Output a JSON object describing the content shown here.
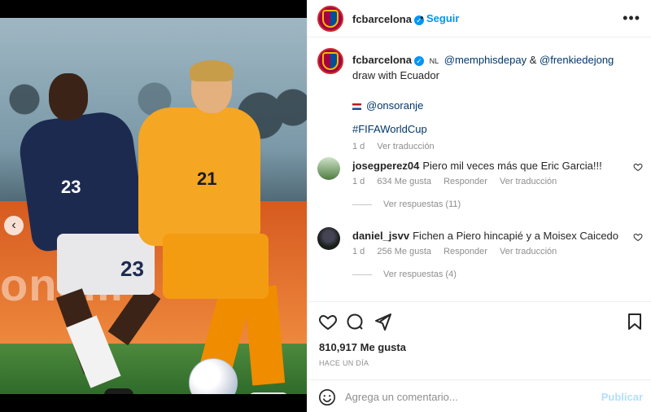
{
  "post_author": {
    "username": "fcbarcelona",
    "follow_label": "Seguir",
    "separator": "•",
    "more_icon": "more-horizontal-icon"
  },
  "media": {
    "board_text": "onelli",
    "jersey_number_ecuador": "23",
    "shorts_number_ecuador": "23",
    "jersey_number_netherlands": "21",
    "prev_icon": "chevron-left-icon"
  },
  "caption": {
    "username": "fcbarcelona",
    "country_code": "NL",
    "mention1": "@memphisdepay",
    "amp": "&",
    "mention2": "@frenkiedejong",
    "text": "draw with Ecuador",
    "mention3": "@onsoranje",
    "hashtag": "#FIFAWorldCup",
    "time": "1 d",
    "translate": "Ver traducción"
  },
  "comments": [
    {
      "username": "josegperez04",
      "text": "Piero mil veces más que Eric Garcia!!!",
      "time": "1 d",
      "likes": "634 Me gusta",
      "reply": "Responder",
      "translate": "Ver traducción",
      "replies": "Ver respuestas (11)"
    },
    {
      "username": "daniel_jsvv",
      "text": "Fichen a Piero hincapié y a Moisex Caicedo",
      "time": "1 d",
      "likes": "256 Me gusta",
      "reply": "Responder",
      "translate": "Ver traducción",
      "replies": "Ver respuestas (4)"
    }
  ],
  "actions": {
    "like_icon": "heart-icon",
    "comment_icon": "comment-icon",
    "share_icon": "send-icon",
    "save_icon": "bookmark-icon",
    "likes_count": "810,917",
    "likes_label": "Me gusta",
    "time_ago": "HACE UN DÍA"
  },
  "compose": {
    "placeholder": "Agrega un comentario...",
    "publish_label": "Publicar",
    "emoji_icon": "emoji-icon"
  },
  "colors": {
    "accent": "#0095f6",
    "link": "#00376b",
    "muted": "#8e8e8e",
    "publish_disabled": "#b2dffc"
  }
}
